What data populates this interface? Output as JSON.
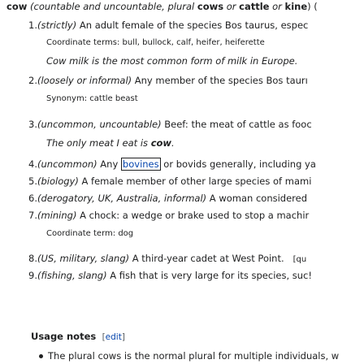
{
  "headword": {
    "word": "cow",
    "gloss_open": "(",
    "gloss": "countable and uncountable, plural",
    "plural1": "cows",
    "or": "or",
    "plural2": "cattle",
    "or2": "or",
    "plural3": "kine",
    "tail": ") ("
  },
  "senses": [
    {
      "num": "1.",
      "label": "(strictly)",
      "text": " An adult female of the species Bos taurus, espec"
    },
    {
      "num": "2.",
      "label": "(loosely or informal)",
      "text": " Any member of the species Bos taurı"
    },
    {
      "num": "3.",
      "label": "(uncommon, uncountable)",
      "text": " Beef: the meat of cattle as fooc"
    },
    {
      "num": "4.",
      "label": "(uncommon)",
      "text_pre": " Any ",
      "link": "bovines",
      "text_post": " or bovids generally, including ya"
    },
    {
      "num": "5.",
      "label": "(biology)",
      "text": " A female member of other large species of mami"
    },
    {
      "num": "6.",
      "label": "(derogatory, UK, Australia, informal)",
      "text": " A woman considered"
    },
    {
      "num": "7.",
      "label": "(mining)",
      "text": " A chock: a wedge or brake used to stop a machir"
    },
    {
      "num": "8.",
      "label": "(US, military, slang)",
      "text": " A third-year cadet at West Point.",
      "tail": "[qu"
    },
    {
      "num": "9.",
      "label": "(fishing, slang)",
      "text": " A fish that is very large for its species, suc!"
    }
  ],
  "sub": {
    "coord1_label": "Coordinate terms:",
    "coord1_list": "bull, bullock, calf, heifer, heiferette",
    "example1": "Cow milk is the most common form of milk in Europe.",
    "syn_label": "Synonym:",
    "syn_value": "cattle beast",
    "example3_pre": "The only meat I eat is ",
    "example3_bold": "cow",
    "example3_post": ".",
    "coord7_label": "Coordinate term:",
    "coord7_value": "dog"
  },
  "usage": {
    "heading": "Usage notes",
    "edit": "edit",
    "bullet": "The plural cows is the normal plural for multiple individuals, w"
  }
}
